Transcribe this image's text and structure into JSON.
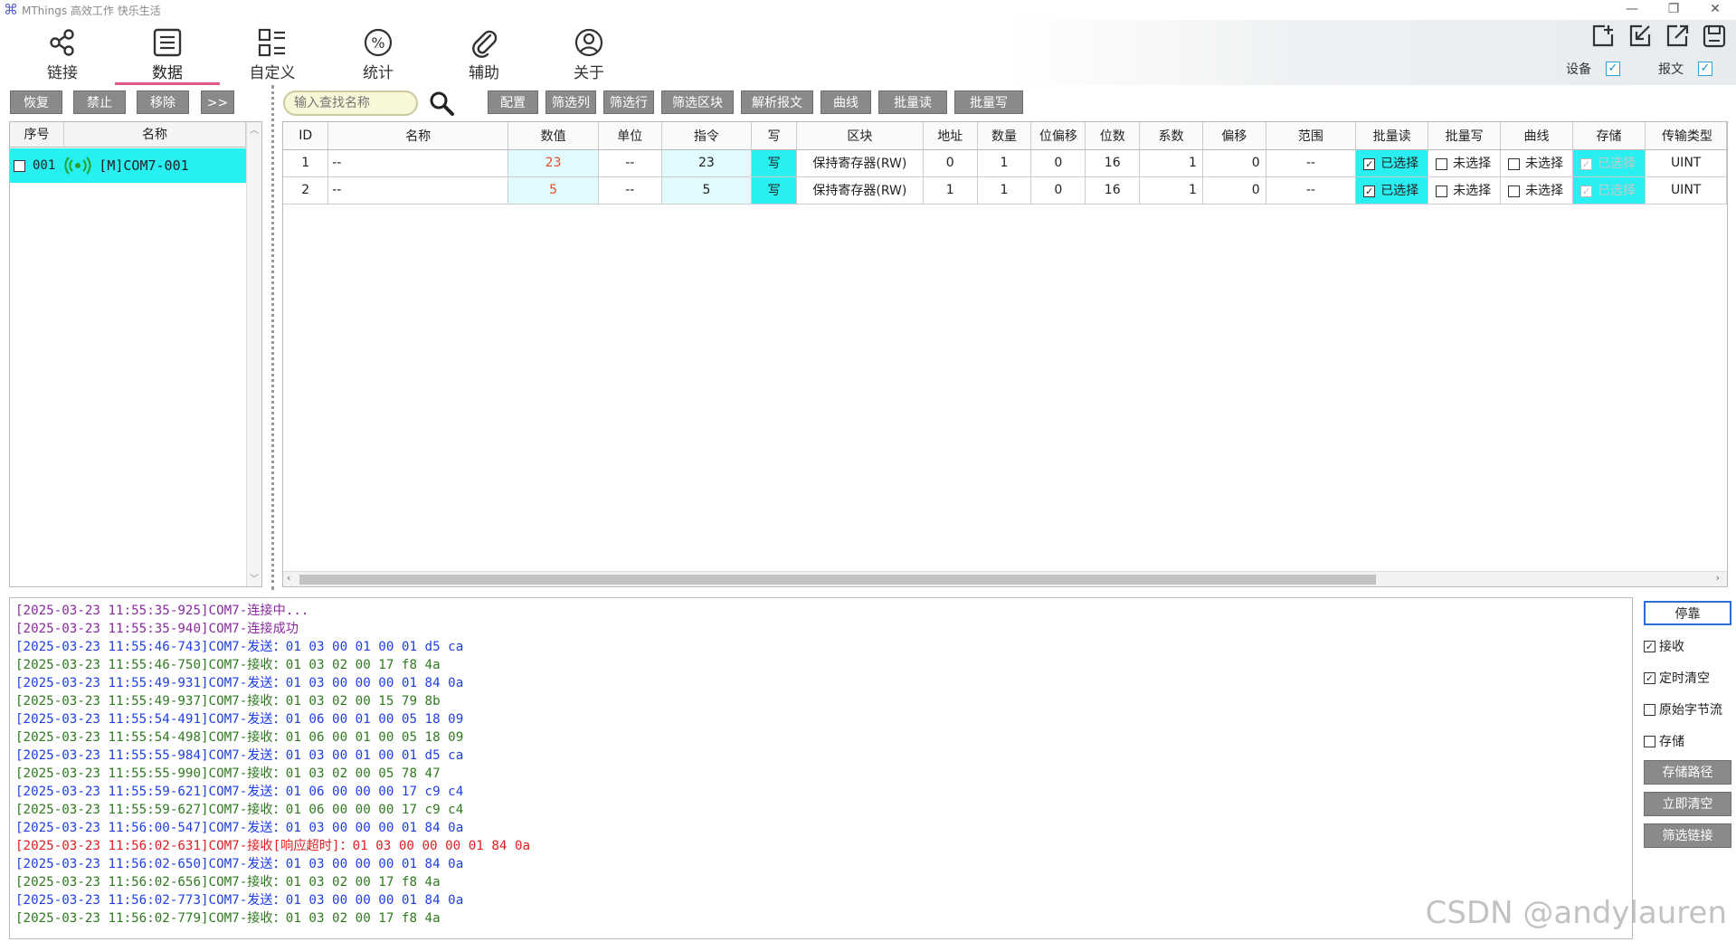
{
  "window": {
    "title": "MThings 高效工作 快乐生活",
    "controls": [
      "—",
      "❐",
      "✕"
    ]
  },
  "nav": {
    "items": [
      {
        "label": "链接",
        "icon": "share-icon"
      },
      {
        "label": "数据",
        "icon": "list-icon"
      },
      {
        "label": "自定义",
        "icon": "layout-icon"
      },
      {
        "label": "统计",
        "icon": "percent-icon"
      },
      {
        "label": "辅助",
        "icon": "paperclip-icon"
      },
      {
        "label": "关于",
        "icon": "user-icon"
      }
    ],
    "active": "数据",
    "device_label": "设备",
    "message_label": "报文"
  },
  "left_toolbar": [
    "恢复",
    "禁止",
    "移除",
    ">>"
  ],
  "search": {
    "placeholder": "输入查找名称"
  },
  "grid_toolbar": [
    "配置",
    "筛选列",
    "筛选行",
    "筛选区块",
    "解析报文",
    "曲线",
    "批量读",
    "批量写"
  ],
  "device_list": {
    "headers": [
      "序号",
      "名称"
    ],
    "rows": [
      {
        "index": "001",
        "name": "[M]COM7-001"
      }
    ]
  },
  "data_grid": {
    "headers": [
      "ID",
      "名称",
      "数值",
      "单位",
      "指令",
      "写",
      "区块",
      "地址",
      "数量",
      "位偏移",
      "位数",
      "系数",
      "偏移",
      "范围",
      "批量读",
      "批量写",
      "曲线",
      "存储",
      "传输类型"
    ],
    "rows": [
      {
        "id": "1",
        "name": "--",
        "value": "23",
        "unit": "--",
        "cmd": "23",
        "write": "写",
        "block": "保持寄存器(RW)",
        "addr": "0",
        "count": "1",
        "bitoff": "0",
        "bits": "16",
        "coef": "1",
        "offset": "0",
        "range": "--",
        "bread": "已选择",
        "bwrite": "未选择",
        "curve": "未选择",
        "store": "已选择",
        "type": "UINT"
      },
      {
        "id": "2",
        "name": "--",
        "value": "5",
        "unit": "--",
        "cmd": "5",
        "write": "写",
        "block": "保持寄存器(RW)",
        "addr": "1",
        "count": "1",
        "bitoff": "0",
        "bits": "16",
        "coef": "1",
        "offset": "0",
        "range": "--",
        "bread": "已选择",
        "bwrite": "未选择",
        "curve": "未选择",
        "store": "已选择",
        "type": "UINT"
      }
    ]
  },
  "log": [
    {
      "c": "purple",
      "t": "[2025-03-23 11:55:35-925]COM7-连接中..."
    },
    {
      "c": "purple",
      "t": "[2025-03-23 11:55:35-940]COM7-连接成功"
    },
    {
      "c": "blue",
      "t": "[2025-03-23 11:55:46-743]COM7-发送：01 03 00 01 00 01 d5 ca"
    },
    {
      "c": "green",
      "t": "[2025-03-23 11:55:46-750]COM7-接收：01 03 02 00 17 f8 4a"
    },
    {
      "c": "blue",
      "t": "[2025-03-23 11:55:49-931]COM7-发送：01 03 00 00 00 01 84 0a"
    },
    {
      "c": "green",
      "t": "[2025-03-23 11:55:49-937]COM7-接收：01 03 02 00 15 79 8b"
    },
    {
      "c": "blue",
      "t": "[2025-03-23 11:55:54-491]COM7-发送：01 06 00 01 00 05 18 09"
    },
    {
      "c": "green",
      "t": "[2025-03-23 11:55:54-498]COM7-接收：01 06 00 01 00 05 18 09"
    },
    {
      "c": "blue",
      "t": "[2025-03-23 11:55:55-984]COM7-发送：01 03 00 01 00 01 d5 ca"
    },
    {
      "c": "green",
      "t": "[2025-03-23 11:55:55-990]COM7-接收：01 03 02 00 05 78 47"
    },
    {
      "c": "blue",
      "t": "[2025-03-23 11:55:59-621]COM7-发送：01 06 00 00 00 17 c9 c4"
    },
    {
      "c": "green",
      "t": "[2025-03-23 11:55:59-627]COM7-接收：01 06 00 00 00 17 c9 c4"
    },
    {
      "c": "blue",
      "t": "[2025-03-23 11:56:00-547]COM7-发送：01 03 00 00 00 01 84 0a"
    },
    {
      "c": "redl",
      "t": "[2025-03-23 11:56:02-631]COM7-接收[响应超时]：01 03 00 00 00 01 84 0a"
    },
    {
      "c": "blue",
      "t": "[2025-03-23 11:56:02-650]COM7-发送：01 03 00 00 00 01 84 0a"
    },
    {
      "c": "green",
      "t": "[2025-03-23 11:56:02-656]COM7-接收：01 03 02 00 17 f8 4a"
    },
    {
      "c": "blue",
      "t": "[2025-03-23 11:56:02-773]COM7-发送：01 03 00 00 00 01 84 0a"
    },
    {
      "c": "green",
      "t": "[2025-03-23 11:56:02-779]COM7-接收：01 03 02 00 17 f8 4a"
    }
  ],
  "log_panel": {
    "stop_button": "停靠",
    "checks": [
      {
        "label": "接收",
        "checked": true
      },
      {
        "label": "定时清空",
        "checked": true
      },
      {
        "label": "原始字节流",
        "checked": false
      },
      {
        "label": "存储",
        "checked": false
      }
    ],
    "buttons": [
      "存储路径",
      "立即清空",
      "筛选链接"
    ]
  },
  "watermark": "CSDN @andylauren"
}
